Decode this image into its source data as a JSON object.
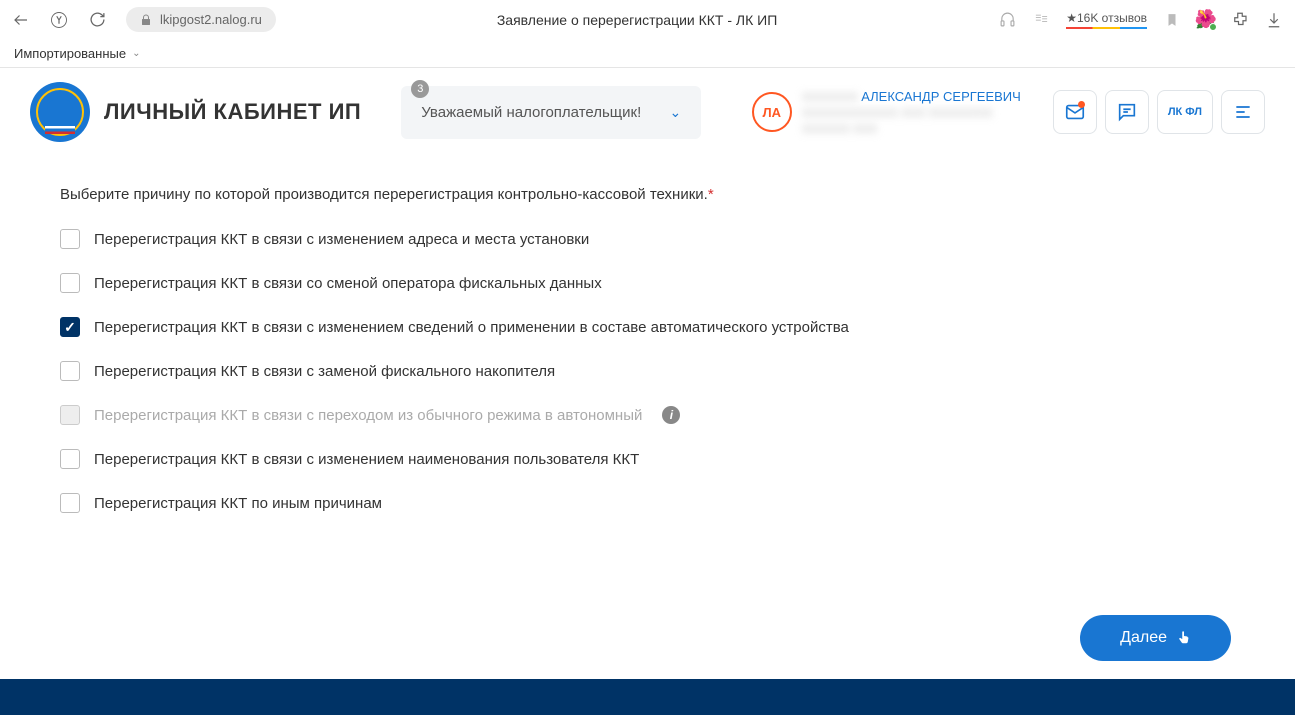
{
  "browser": {
    "url": "lkipgost2.nalog.ru",
    "pageTitle": "Заявление о перерегистрации ККТ - ЛК ИП",
    "reviews": "16K отзывов"
  },
  "bookmarks": {
    "imported": "Импортированные"
  },
  "header": {
    "appTitle": "ЛИЧНЫЙ КАБИНЕТ ИП",
    "noticeBadge": "3",
    "noticeText": "Уважаемый налогоплательщик!",
    "avatarInitials": "ЛА",
    "userName": "АЛЕКСАНДР СЕРГЕЕВИЧ",
    "userLine2": "XXXXXXXXXXXX  XXX XXXXXXXX",
    "userLine3": "XXXXXX XXX",
    "lkfl": "ЛК ФЛ"
  },
  "form": {
    "prompt": "Выберите причину по которой производится перерегистрация контрольно-кассовой техники.",
    "options": [
      {
        "label": "Перерегистрация ККТ в связи с изменением адреса и места установки",
        "checked": false,
        "disabled": false
      },
      {
        "label": "Перерегистрация ККТ в связи со сменой оператора фискальных данных",
        "checked": false,
        "disabled": false
      },
      {
        "label": "Перерегистрация ККТ в связи с изменением сведений о применении в составе автоматического устройства",
        "checked": true,
        "disabled": false
      },
      {
        "label": "Перерегистрация ККТ в связи с заменой фискального накопителя",
        "checked": false,
        "disabled": false
      },
      {
        "label": "Перерегистрация ККТ в связи с переходом из обычного режима в автономный",
        "checked": false,
        "disabled": true,
        "info": true
      },
      {
        "label": "Перерегистрация ККТ в связи с изменением наименования пользователя ККТ",
        "checked": false,
        "disabled": false
      },
      {
        "label": "Перерегистрация ККТ по иным причинам",
        "checked": false,
        "disabled": false
      }
    ],
    "nextBtn": "Далее"
  }
}
